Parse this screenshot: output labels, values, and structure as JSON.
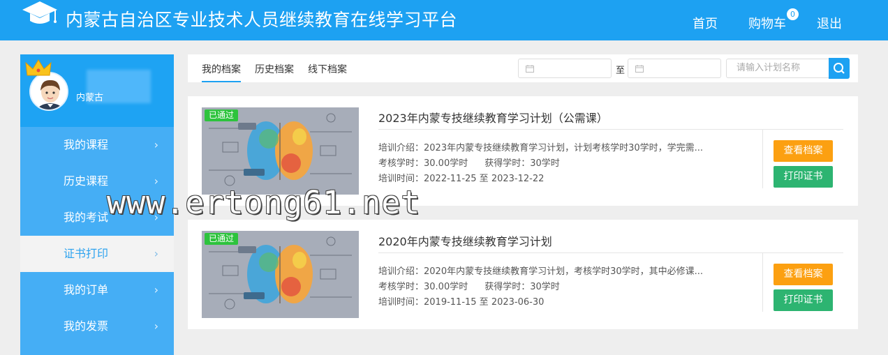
{
  "header": {
    "title": "内蒙古自治区专业技术人员继续教育在线学习平台",
    "nav": {
      "home": "首页",
      "cart": "购物车",
      "cart_count": "0",
      "exit": "退出"
    }
  },
  "sidebar": {
    "username": "内蒙古",
    "items": [
      {
        "label": "我的课程"
      },
      {
        "label": "历史课程"
      },
      {
        "label": "我的考试"
      },
      {
        "label": "证书打印"
      },
      {
        "label": "我的订单"
      },
      {
        "label": "我的发票"
      }
    ],
    "active_index": 3
  },
  "tabs": [
    "我的档案",
    "历史档案",
    "线下档案"
  ],
  "filters": {
    "to_label": "至",
    "search_placeholder": "请输入计划名称"
  },
  "plans": [
    {
      "badge": "已通过",
      "title": "2023年内蒙专技继续教育学习计划（公需课）",
      "intro": "培训介绍：2023年内蒙专技继续教育学习计划，计划考核学时30学时，学完需...",
      "required_hours": "考核学时：30.00学时",
      "earned_hours": "获得学时：30学时",
      "period": "培训时间：2022-11-25 至 2023-12-22",
      "view_label": "查看档案",
      "print_label": "打印证书"
    },
    {
      "badge": "已通过",
      "title": "2020年内蒙专技继续教育学习计划",
      "intro": "培训介绍：2020年内蒙专技继续教育学习计划，考核学时30学时，其中必修课...",
      "required_hours": "考核学时：30.00学时",
      "earned_hours": "获得学时：30学时",
      "period": "培训时间：2019-11-15 至 2023-06-30",
      "view_label": "查看档案",
      "print_label": "打印证书"
    }
  ],
  "watermark": "www.ertong61.net",
  "colors": {
    "primary": "#1da1f2",
    "orange": "#fca011",
    "green": "#2db471",
    "passed": "#2dc33d"
  }
}
